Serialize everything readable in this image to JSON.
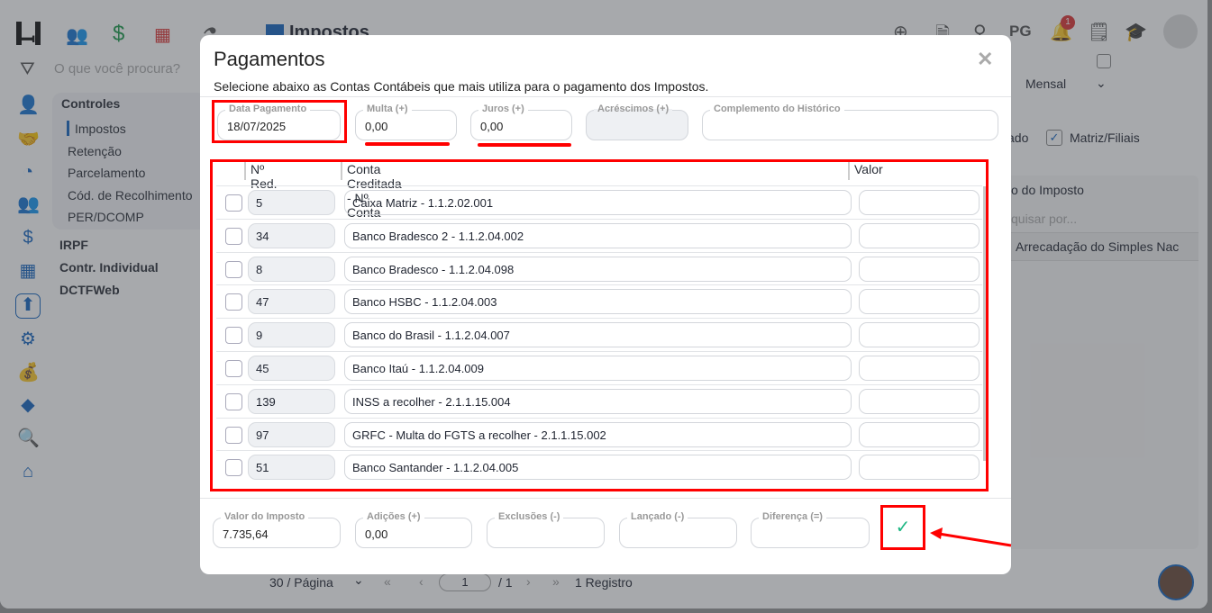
{
  "topbar": {
    "title": "Impostos",
    "pg_label": "PG",
    "notification_count": "1"
  },
  "search": {
    "placeholder": "O que você procura?"
  },
  "menu": {
    "section": "Controles",
    "items": [
      "Impostos",
      "Retenção",
      "Parcelamento",
      "Cód. de Recolhimento",
      "PER/DCOMP"
    ],
    "groups": [
      "IRPF",
      "Contr. Individual",
      "DCTFWeb"
    ]
  },
  "background": {
    "period": "Mensal",
    "consolidado_partial": "ado",
    "matriz_filiais": "Matriz/Filiais",
    "col_partial": "o do Imposto",
    "search_partial": "quisar por...",
    "row_partial": "Arrecadação do Simples Nac",
    "per_page": "30 / Página",
    "page": "1",
    "page_total": "/ 1",
    "records": "1 Registro"
  },
  "modal": {
    "title": "Pagamentos",
    "subtitle": "Selecione abaixo as Contas Contábeis que mais utiliza para o pagamento dos Impostos.",
    "fields": {
      "data_label": "Data Pagamento",
      "data_value": "18/07/2025",
      "multa_label": "Multa (+)",
      "multa_value": "0,00",
      "juros_label": "Juros (+)",
      "juros_value": "0,00",
      "acrescimos_label": "Acréscimos (+)",
      "complemento_label": "Complemento do Histórico"
    },
    "table": {
      "headers": [
        "Nº Red.",
        "Conta Creditada - Nº Conta",
        "Valor"
      ],
      "rows": [
        {
          "red": "5",
          "conta": "Caixa Matriz  - 1.1.2.02.001"
        },
        {
          "red": "34",
          "conta": "Banco Bradesco  2 - 1.1.2.04.002"
        },
        {
          "red": "8",
          "conta": "Banco Bradesco - 1.1.2.04.098"
        },
        {
          "red": "47",
          "conta": "Banco HSBC - 1.1.2.04.003"
        },
        {
          "red": "9",
          "conta": "Banco do Brasil - 1.1.2.04.007"
        },
        {
          "red": "45",
          "conta": "Banco Itaú - 1.1.2.04.009"
        },
        {
          "red": "139",
          "conta": "INSS a recolher - 2.1.1.15.004"
        },
        {
          "red": "97",
          "conta": "GRFC - Multa do FGTS a recolher - 2.1.1.15.002"
        },
        {
          "red": "51",
          "conta": "Banco Santander - 1.1.2.04.005"
        }
      ]
    },
    "totals": {
      "valor_label": "Valor do Imposto",
      "valor_value": "7.735,64",
      "adicoes_label": "Adições (+)",
      "adicoes_value": "0,00",
      "exclusoes_label": "Exclusões (-)",
      "lancado_label": "Lançado (-)",
      "diferenca_label": "Diferença (=)"
    },
    "colors": {
      "confirm": "#1fb784",
      "annotation": "#ff0000"
    }
  }
}
